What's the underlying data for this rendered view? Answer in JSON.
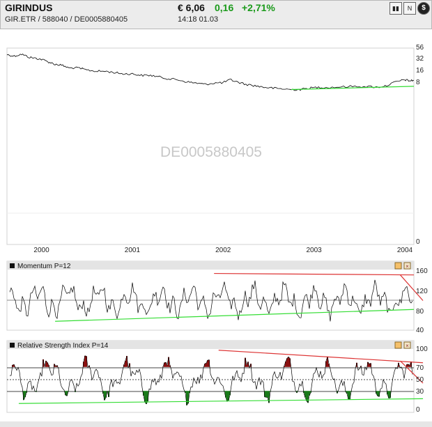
{
  "header": {
    "name": "GIRINDUS",
    "ids": "GIR.ETR   /   588040   /   DE0005880405",
    "price": "€ 6,06",
    "change": "0,16",
    "percent": "+2,71%",
    "time": "14:18   01.03",
    "icons": [
      "chart-type-icon",
      "news-icon",
      "dollar-icon"
    ],
    "icon_glyphs": [
      "▮▮",
      "N",
      "$"
    ]
  },
  "chart_data": [
    {
      "type": "line",
      "title": "",
      "watermark": "DE0005880405",
      "x_ticks": [
        "2000",
        "2001",
        "2002",
        "2003",
        "2004"
      ],
      "x_tick_values": [
        2000.0,
        2001.0,
        2002.0,
        2003.0,
        2004.0
      ],
      "y_ticks": [
        "56",
        "32",
        "16",
        "8",
        "0"
      ],
      "x_range": [
        1999.62,
        2004.1
      ],
      "scale": "log",
      "series": [
        {
          "values": [
            [
              1999.62,
              37
            ],
            [
              1999.7,
              34
            ],
            [
              1999.78,
              38
            ],
            [
              1999.86,
              32
            ],
            [
              1999.93,
              30
            ],
            [
              2000.0,
              28
            ],
            [
              2000.08,
              24
            ],
            [
              2000.15,
              21
            ],
            [
              2000.22,
              20
            ],
            [
              2000.3,
              17
            ],
            [
              2000.4,
              17
            ],
            [
              2000.5,
              15
            ],
            [
              2000.6,
              14
            ],
            [
              2000.7,
              14
            ],
            [
              2000.8,
              13
            ],
            [
              2000.9,
              12
            ],
            [
              2001.0,
              12
            ],
            [
              2001.1,
              11
            ],
            [
              2001.2,
              11
            ],
            [
              2001.3,
              10
            ],
            [
              2001.4,
              9
            ],
            [
              2001.5,
              8.5
            ],
            [
              2001.6,
              7.5
            ],
            [
              2001.7,
              7
            ],
            [
              2001.8,
              6.5
            ],
            [
              2001.9,
              7
            ],
            [
              2002.0,
              7.2
            ],
            [
              2002.08,
              8.5
            ],
            [
              2002.15,
              7.5
            ],
            [
              2002.25,
              6.5
            ],
            [
              2002.35,
              6
            ],
            [
              2002.45,
              5.5
            ],
            [
              2002.55,
              5.2
            ],
            [
              2002.65,
              5
            ],
            [
              2002.75,
              4.8
            ],
            [
              2002.85,
              4.8
            ],
            [
              2002.95,
              5.2
            ],
            [
              2003.05,
              5.5
            ],
            [
              2003.15,
              5.4
            ],
            [
              2003.3,
              5.6
            ],
            [
              2003.45,
              5.8
            ],
            [
              2003.6,
              5.7
            ],
            [
              2003.7,
              5.5
            ],
            [
              2003.8,
              6
            ],
            [
              2003.9,
              7.5
            ],
            [
              2004.0,
              8.5
            ],
            [
              2004.05,
              8
            ],
            [
              2004.1,
              8.2
            ]
          ]
        }
      ],
      "trendlines": [
        {
          "color": "#33dd33",
          "from": [
            2002.75,
            4.8
          ],
          "to": [
            2004.1,
            5.8
          ]
        }
      ]
    },
    {
      "type": "line",
      "title": "Momentum P=12",
      "y_ticks": [
        "160",
        "120",
        "80",
        "40"
      ],
      "y_range": [
        40,
        160
      ],
      "reference_line": 100,
      "trendlines": [
        {
          "color": "#dd3333",
          "from": [
            2001.9,
            155
          ],
          "to": [
            2004.1,
            152
          ]
        },
        {
          "color": "#dd3333",
          "from": [
            2003.95,
            152
          ],
          "to": [
            2004.2,
            100
          ]
        },
        {
          "color": "#33dd33",
          "from": [
            2000.15,
            58
          ],
          "to": [
            2004.1,
            82
          ]
        }
      ]
    },
    {
      "type": "line",
      "title": "Relative Strength Index P=14",
      "y_ticks": [
        "100",
        "70",
        "50",
        "30",
        "0"
      ],
      "y_range": [
        0,
        100
      ],
      "bands": [
        70,
        50,
        30
      ],
      "overbought_color": "#8b1010",
      "oversold_color": "#1a7a1a",
      "trendlines": [
        {
          "color": "#dd3333",
          "from": [
            2001.95,
            98
          ],
          "to": [
            2004.2,
            77
          ]
        },
        {
          "color": "#dd3333",
          "from": [
            2003.95,
            80
          ],
          "to": [
            2004.2,
            43
          ]
        },
        {
          "color": "#33dd33",
          "from": [
            1999.75,
            9
          ],
          "to": [
            2004.2,
            17
          ]
        }
      ]
    }
  ]
}
